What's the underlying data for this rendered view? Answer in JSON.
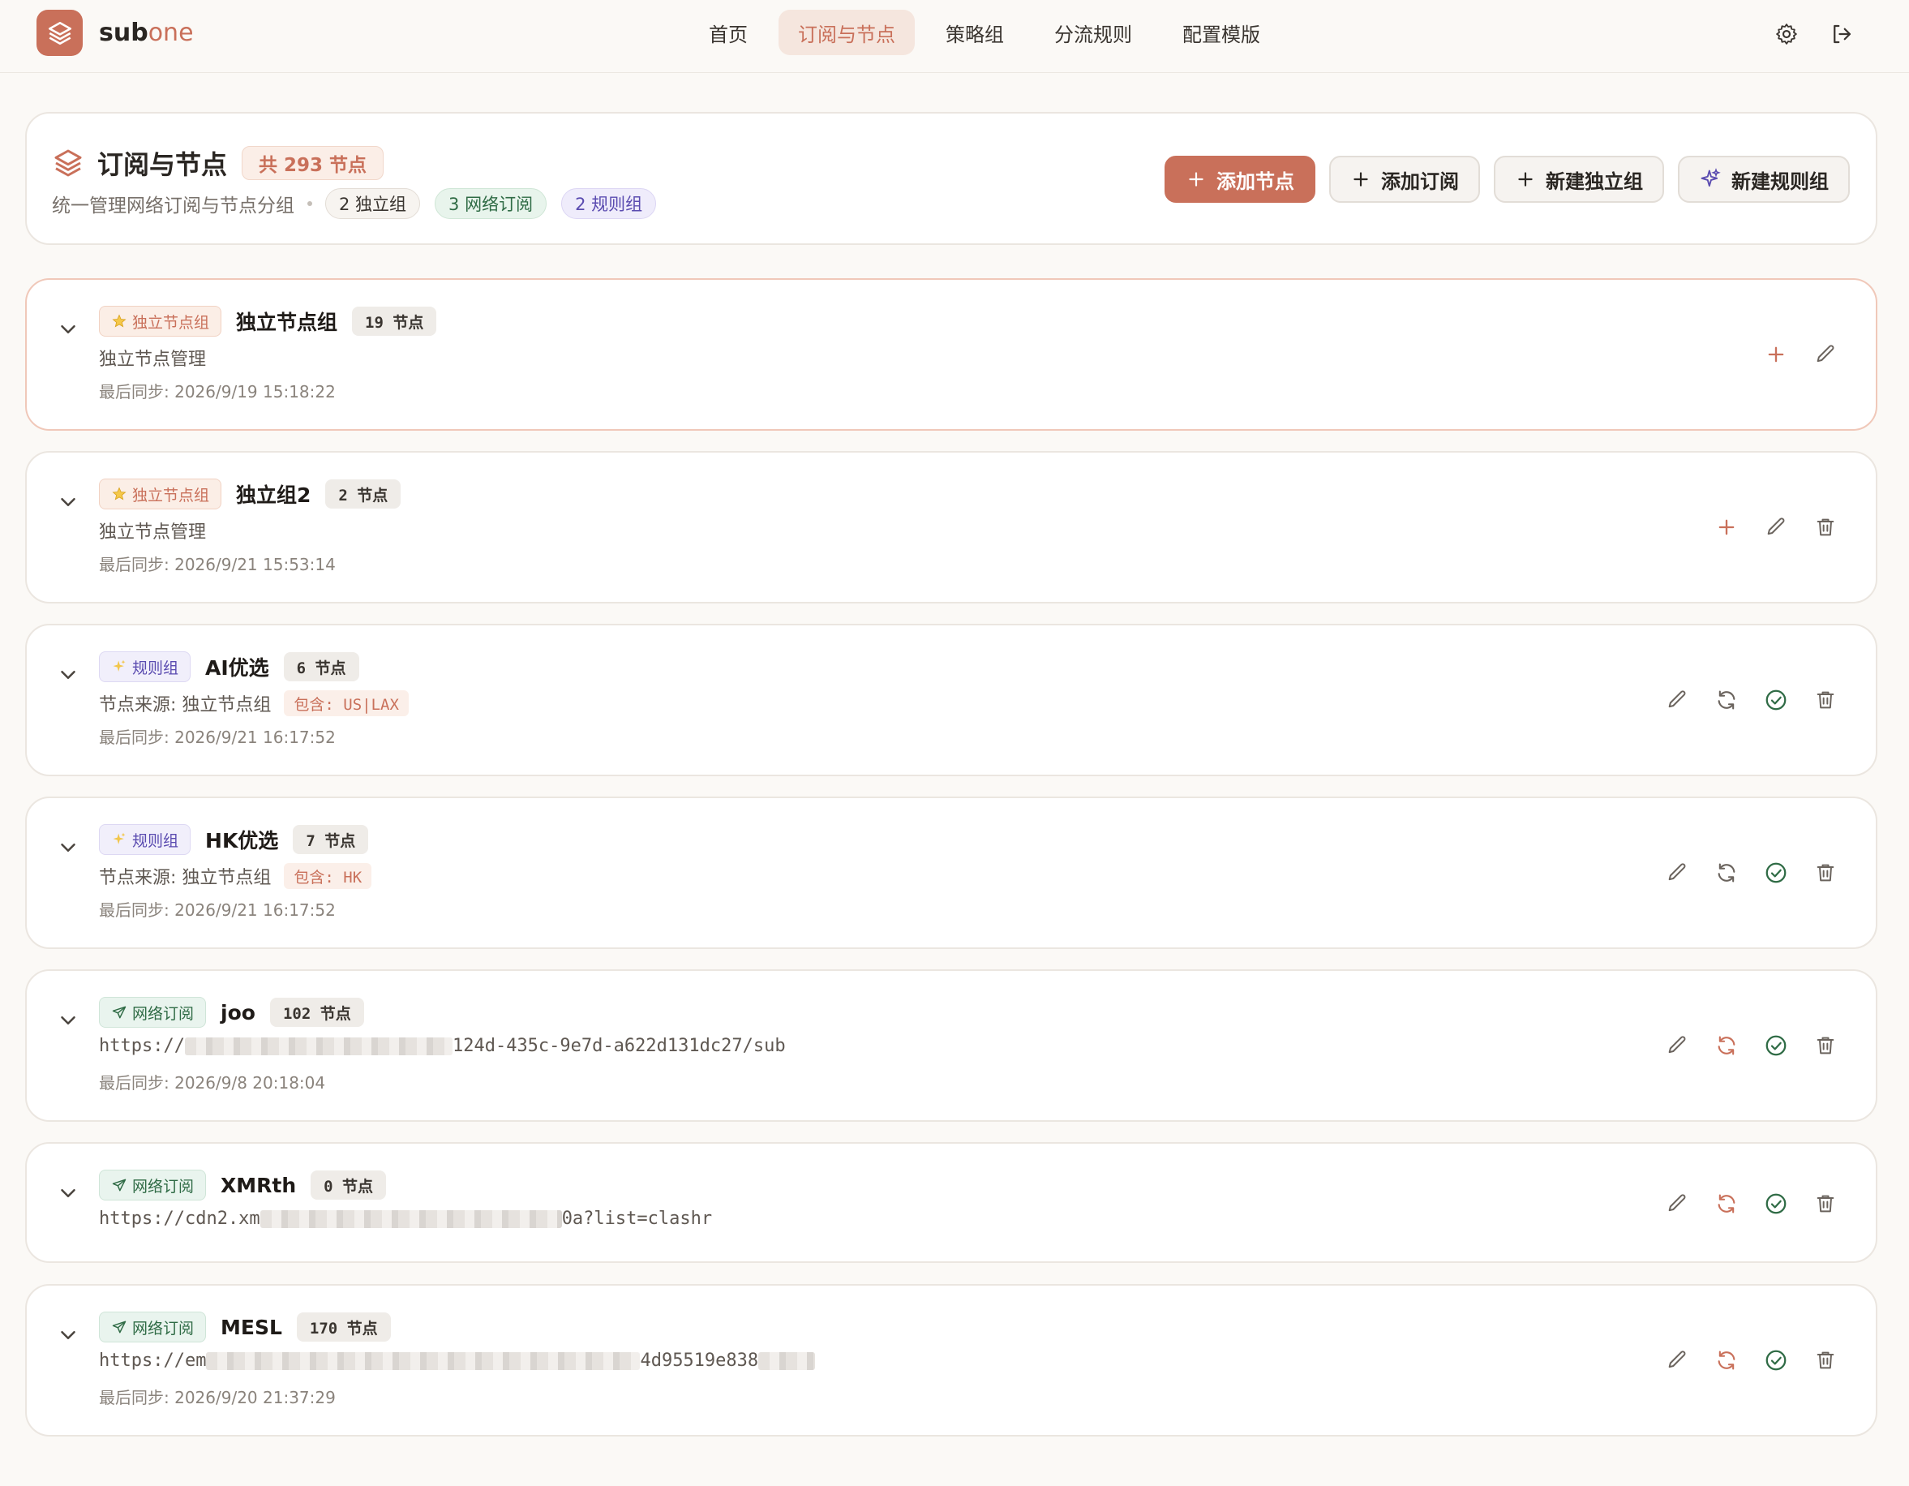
{
  "brand": {
    "name_main": "sub",
    "name_accent": "one"
  },
  "nav": [
    {
      "label": "首页"
    },
    {
      "label": "订阅与节点",
      "active": true
    },
    {
      "label": "策略组"
    },
    {
      "label": "分流规则"
    },
    {
      "label": "配置模版"
    }
  ],
  "header": {
    "title": "订阅与节点",
    "total_badge": "共 293 节点",
    "subtitle": "统一管理网络订阅与节点分组",
    "pills": {
      "independent": "2 独立组",
      "subscriptions": "3 网络订阅",
      "rules": "2 规则组"
    },
    "buttons": {
      "add_node": "添加节点",
      "add_subscription": "添加订阅",
      "new_independent": "新建独立组",
      "new_rule": "新建规则组"
    }
  },
  "colors": {
    "accent": "#c9705a",
    "green": "#2f6b45",
    "purple": "#5a4bb0"
  },
  "groups": [
    {
      "type": "独立节点组",
      "name": "独立节点组",
      "count": "19 节点",
      "line2": "独立节点管理",
      "line3": "最后同步: 2026/9/19 15:18:22"
    },
    {
      "type": "独立节点组",
      "name": "独立组2",
      "count": "2 节点",
      "line2": "独立节点管理",
      "line3": "最后同步: 2026/9/21 15:53:14"
    },
    {
      "type": "规则组",
      "name": "AI优选",
      "count": "6 节点",
      "line2": "节点来源: 独立节点组",
      "filter": "包含: US|LAX",
      "line3": "最后同步: 2026/9/21 16:17:52"
    },
    {
      "type": "规则组",
      "name": "HK优选",
      "count": "7 节点",
      "line2": "节点来源: 独立节点组",
      "filter": "包含: HK",
      "line3": "最后同步: 2026/9/21 16:17:52"
    },
    {
      "type": "网络订阅",
      "name": "joo",
      "count": "102 节点",
      "url_start": "https://",
      "url_end": "124d-435c-9e7d-a622d131dc27/sub",
      "line3": "最后同步: 2026/9/8 20:18:04"
    },
    {
      "type": "网络订阅",
      "name": "XMRth",
      "count": "0 节点",
      "url_start": "https://cdn2.xm",
      "url_end": "0a?list=clashr"
    },
    {
      "type": "网络订阅",
      "name": "MESL",
      "count": "170 节点",
      "url_start": "https://em",
      "url_end": "4d95519e838",
      "line3": "最后同步: 2026/9/20 21:37:29"
    }
  ]
}
